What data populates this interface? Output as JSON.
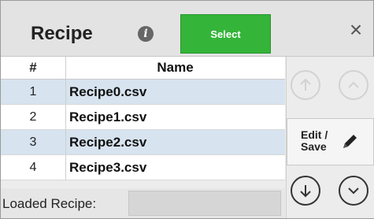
{
  "header": {
    "title": "Recipe",
    "info_icon": "info-icon",
    "select_label": "Select",
    "close_glyph": "×"
  },
  "table": {
    "columns": [
      "#",
      "Name"
    ],
    "rows": [
      {
        "num": "1",
        "name": "Recipe0.csv",
        "selected": true
      },
      {
        "num": "2",
        "name": "Recipe1.csv",
        "selected": false
      },
      {
        "num": "3",
        "name": "Recipe2.csv",
        "selected": true
      },
      {
        "num": "4",
        "name": "Recipe3.csv",
        "selected": false
      }
    ]
  },
  "footer": {
    "loaded_label": "Loaded Recipe:",
    "loaded_value": ""
  },
  "side": {
    "edit_label": "Edit /\nSave",
    "buttons": {
      "first": "arrow-up-circle-icon",
      "page_up": "chevron-up-circle-icon",
      "edit": "pencil-icon",
      "down": "arrow-down-circle-icon",
      "page_down": "chevron-down-circle-icon"
    }
  },
  "colors": {
    "select_green": "#34b53a",
    "selected_row": "#d7e3ef",
    "header_bg": "#e3e3e3"
  }
}
